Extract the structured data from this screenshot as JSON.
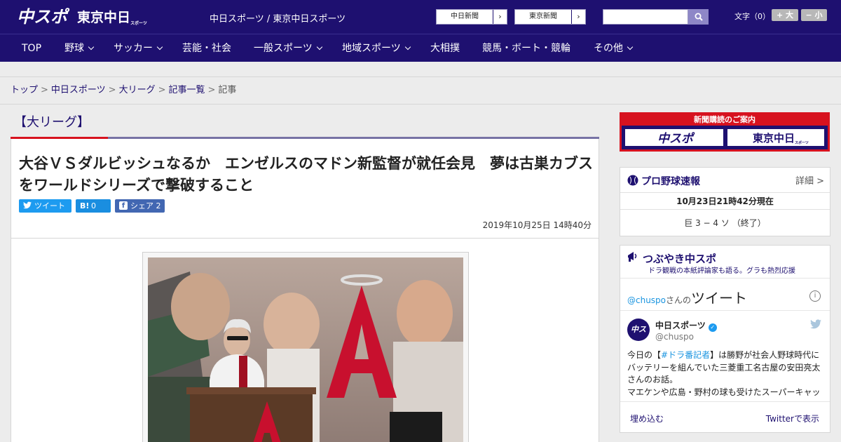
{
  "header": {
    "site_title": "中日スポーツ / 東京中日スポーツ",
    "papers": [
      {
        "label": "中日新聞",
        "arrow": "›"
      },
      {
        "label": "東京新聞",
        "arrow": "›"
      }
    ],
    "search": {
      "placeholder": "",
      "value": "",
      "icon": "search-icon"
    },
    "font_size": {
      "label": "文字（0）",
      "larger": "+ 大",
      "smaller": "− 小"
    },
    "logos": {
      "chuspo": "中スポ",
      "tokyo": "東京中日",
      "tokyo_sub": "スポーツ"
    },
    "colors": {
      "brand": "#1e1070",
      "accent": "#d7121f"
    }
  },
  "nav": {
    "items": [
      {
        "label": "TOP",
        "dropdown": false
      },
      {
        "label": "野球",
        "dropdown": true
      },
      {
        "label": "サッカー",
        "dropdown": true
      },
      {
        "label": "芸能・社会",
        "dropdown": false
      },
      {
        "label": "一般スポーツ",
        "dropdown": true
      },
      {
        "label": "地域スポーツ",
        "dropdown": true
      },
      {
        "label": "大相撲",
        "dropdown": false
      },
      {
        "label": "競馬・ボート・競輪",
        "dropdown": false
      },
      {
        "label": "その他",
        "dropdown": true
      }
    ]
  },
  "breadcrumb": {
    "items": [
      "トップ",
      "中日スポーツ",
      "大リーグ",
      "記事一覧"
    ],
    "current": "記事",
    "separator": ">"
  },
  "article": {
    "category": "【大リーグ】",
    "headline": "大谷ＶＳダルビッシュなるか　エンゼルスのマドン新監督が就任会見　夢は古巣カブスをワールドシリーズで撃破すること",
    "share": {
      "tweet": {
        "icon": "twitter-icon",
        "label": "ツイート"
      },
      "hatena": {
        "icon": "B!",
        "count": "0"
      },
      "facebook": {
        "icon": "f",
        "label": "シェア 2"
      }
    },
    "date": "2019年10月25日 14時40分",
    "photo_logo_letter": "A"
  },
  "sidebar": {
    "subscribe": {
      "heading": "新聞購読のご案内",
      "chuspo": "中スポ",
      "tokyo": "東京中日",
      "tokyo_sub": "スポーツ"
    },
    "score": {
      "title": "プロ野球速報",
      "detail": "詳細 >",
      "time": "10月23日21時42分現在",
      "line": "巨 3 − 4 ソ （終了）"
    },
    "twitter": {
      "title": "つぶやき中スポ",
      "subtitle": "ドラ観戦の本紙評論家も語る。グラも熱烈応援",
      "embed_handle": "@chuspo",
      "embed_san": "さんの",
      "embed_big": "ツイート",
      "info": "i",
      "tweet": {
        "avatar_text": "中スポ",
        "name": "中日スポーツ",
        "badge": "✓",
        "handle": "@chuspo",
        "text_pre": "今日の【",
        "hashtag": "#ドラ番記者",
        "text_post": "】は勝野が社会人野球時代にバッテリーを組んでいた三菱重工名古屋の安田亮太さんのお話。",
        "text_line2": "マエケンや広島・野村の球も受けたスーパーキャッ"
      },
      "embed_link": "埋め込む",
      "view_link": "Twitterで表示"
    }
  }
}
